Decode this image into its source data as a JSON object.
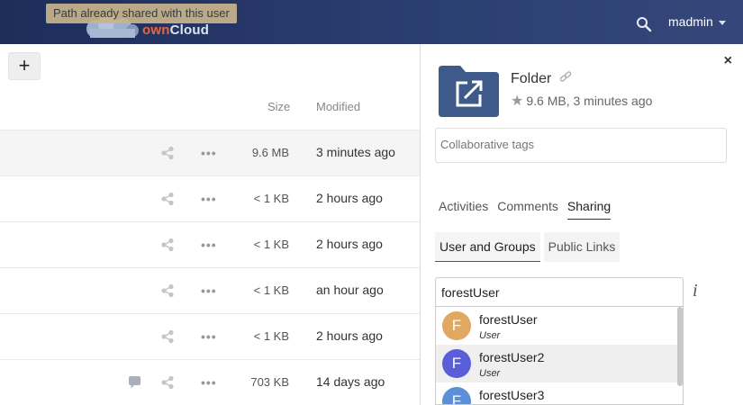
{
  "header": {
    "tooltip": "Path already shared with this user",
    "logo_own": "own",
    "logo_cloud": "Cloud",
    "username": "madmin"
  },
  "files": {
    "add_label": "+",
    "columns": {
      "size": "Size",
      "modified": "Modified"
    },
    "rows": [
      {
        "size": "9.6 MB",
        "modified": "3 minutes ago",
        "selected": true,
        "comments": false
      },
      {
        "size": "< 1 KB",
        "modified": "2 hours ago",
        "selected": false,
        "comments": false
      },
      {
        "size": "< 1 KB",
        "modified": "2 hours ago",
        "selected": false,
        "comments": false
      },
      {
        "size": "< 1 KB",
        "modified": "an hour ago",
        "selected": false,
        "comments": false
      },
      {
        "size": "< 1 KB",
        "modified": "2 hours ago",
        "selected": false,
        "comments": false
      },
      {
        "size": "703 KB",
        "modified": "14 days ago",
        "selected": false,
        "comments": true
      }
    ],
    "more_label": "•••"
  },
  "sidebar": {
    "close_label": "×",
    "folder_name": "Folder",
    "folder_meta": "9.6 MB, 3 minutes ago",
    "tags_placeholder": "Collaborative tags",
    "tabs": [
      {
        "label": "Activities",
        "active": false
      },
      {
        "label": "Comments",
        "active": false
      },
      {
        "label": "Sharing",
        "active": true
      }
    ],
    "subtabs": [
      {
        "label": "User and Groups",
        "active": true
      },
      {
        "label": "Public Links",
        "active": false
      }
    ],
    "share_input_value": "forestUser",
    "info_label": "i",
    "suggestions": [
      {
        "initial": "F",
        "name": "forestUser",
        "type": "User",
        "color": "#e0a860"
      },
      {
        "initial": "F",
        "name": "forestUser2",
        "type": "User",
        "color": "#5a5fd8"
      },
      {
        "initial": "F",
        "name": "forestUser3",
        "type": "",
        "color": "#5b8fd6"
      }
    ]
  },
  "colors": {
    "header_bg": "#2c3f72",
    "folder_icon": "#3b5998",
    "logo_orange": "#e8663c"
  }
}
